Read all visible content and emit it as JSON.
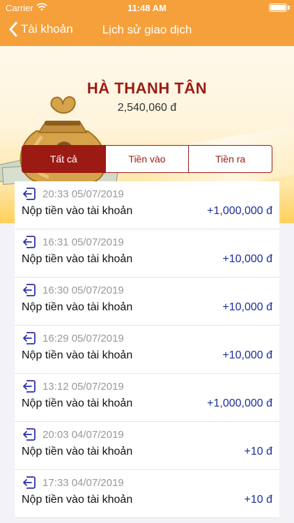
{
  "status_bar": {
    "carrier": "Carrier",
    "time": "11:48 AM"
  },
  "nav": {
    "back_label": "Tài khoản",
    "title": "Lịch sử giao dịch"
  },
  "account": {
    "name": "HÀ THANH TÂN",
    "balance": "2,540,060 đ"
  },
  "tabs": [
    {
      "label": "Tất cả",
      "active": true
    },
    {
      "label": "Tiền vào",
      "active": false
    },
    {
      "label": "Tiền ra",
      "active": false
    }
  ],
  "transactions": [
    {
      "time": "20:33 05/07/2019",
      "description": "Nộp tiền vào tài khoản",
      "amount": "+1,000,000 đ"
    },
    {
      "time": "16:31 05/07/2019",
      "description": "Nộp tiền vào tài khoản",
      "amount": "+10,000 đ"
    },
    {
      "time": "16:30 05/07/2019",
      "description": "Nộp tiền vào tài khoản",
      "amount": "+10,000 đ"
    },
    {
      "time": "16:29 05/07/2019",
      "description": "Nộp tiền vào tài khoản",
      "amount": "+10,000 đ"
    },
    {
      "time": "13:12 05/07/2019",
      "description": "Nộp tiền vào tài khoản",
      "amount": "+1,000,000 đ"
    },
    {
      "time": "20:03 04/07/2019",
      "description": "Nộp tiền vào tài khoản",
      "amount": "+10 đ"
    },
    {
      "time": "17:33 04/07/2019",
      "description": "Nộp tiền vào tài khoản",
      "amount": "+10 đ"
    }
  ],
  "colors": {
    "header": "#f5a03a",
    "accent": "#9b1b14",
    "amount": "#1a2e9a",
    "icon": "#2c2fa8"
  },
  "icons": {
    "back": "chevron-left-icon",
    "wifi": "wifi-icon",
    "battery": "battery-icon",
    "deposit": "deposit-in-icon",
    "hero": "money-bag-icon"
  }
}
